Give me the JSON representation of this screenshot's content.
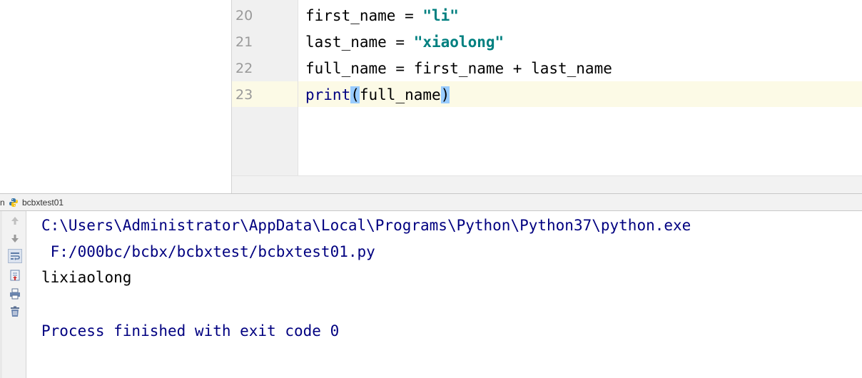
{
  "editor": {
    "lines": [
      {
        "number": "20",
        "parts": [
          "first_name = ",
          "\"li\""
        ]
      },
      {
        "number": "21",
        "parts": [
          "last_name = ",
          "\"xiaolong\""
        ]
      },
      {
        "number": "22",
        "text": "full_name = first_name + last_name"
      },
      {
        "number": "23",
        "fn": "print",
        "open": "(",
        "arg": "full_name",
        "close": ")"
      }
    ],
    "current_line": "23"
  },
  "run_window": {
    "tab_prefix": "n",
    "tab_label": "bcbxtest01",
    "toolbar": [
      {
        "name": "rerun-up-icon"
      },
      {
        "name": "down-arrow-icon"
      },
      {
        "name": "soft-wrap-icon"
      },
      {
        "name": "scroll-to-end-icon"
      },
      {
        "name": "print-icon"
      },
      {
        "name": "trash-icon"
      }
    ],
    "console": {
      "command_line_1": "C:\\Users\\Administrator\\AppData\\Local\\Programs\\Python\\Python37\\python.exe",
      "command_line_2": " F:/000bc/bcbx/bcbxtest/bcbxtest01.py",
      "output": "lixiaolong",
      "exit_message": "Process finished with exit code 0"
    }
  },
  "colors": {
    "string": "#008080",
    "console_path": "#000080",
    "current_line_bg": "#fcfae6",
    "paren_match_bg": "#99ccff"
  }
}
